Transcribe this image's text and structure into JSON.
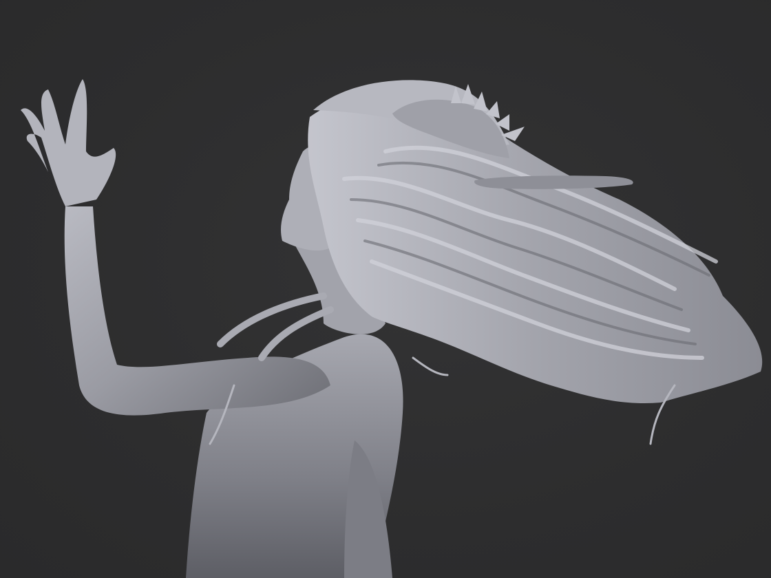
{
  "scene": {
    "background_color": "#2e2e2f",
    "material_color": "#9a9ba3",
    "highlight_color": "#c9cad2",
    "shadow_color": "#55565c"
  }
}
